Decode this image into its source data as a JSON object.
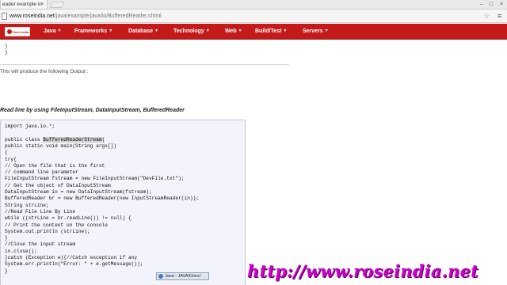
{
  "browser": {
    "tab_title": "eader example in",
    "tab_close": "×",
    "url_host": "www.roseindia.net",
    "url_path": "/java/example/java/io/BufferedReader.shtml",
    "controls": {
      "minimize": "–",
      "restore": "□",
      "close": "×"
    },
    "star_glyph": "☆",
    "menu_glyph": "≡"
  },
  "site": {
    "logo_text": "Rose India",
    "nav_items": [
      "Java",
      "Frameworks",
      "Database",
      "Technology",
      "Web",
      "Build/Test",
      "Servers"
    ],
    "caret": "▼"
  },
  "content": {
    "top_lines": [
      "}",
      "}"
    ],
    "output_text": "This will produce the following Output :",
    "section_heading": "Read line by using FileInputStream, DataInputStream, BufferedReader",
    "code_lines": [
      "import java.io.*;",
      "",
      "public class BufferedReaderStream{",
      "public static void main(String args[])",
      "{",
      "try{",
      "// Open the file that is the first",
      "// command line parameter",
      "FileInputStream fstream = new FileInputStream(\"DevFile.txt\");",
      "// Get the object of DataInputStream",
      "DataInputStream in = new DataInputStream(fstream);",
      "BufferedReader br = new BufferedReader(new InputStreamReader(in));",
      "String strLine;",
      "//Read File Line By Line",
      "while ((strLine = br.readLine()) != null) {",
      "// Print the content on the console",
      "System.out.println (strLine);",
      "}",
      "//Close the input stream",
      "in.close();",
      "}catch (Exception e){//Catch exception if any",
      "System.err.println(\"Error: \" + e.getMessage());",
      "}"
    ],
    "code_highlight": {
      "prefix": "public class ",
      "word": "BufferedReaderStream",
      "suffix": "{"
    }
  },
  "taskbar": {
    "label": "Java - JAVAIO/src/"
  },
  "watermark": "http://www.roseindia.net",
  "colors": {
    "nav_red": "#c41a1a",
    "watermark": "#cc00cc",
    "code_bg": "#f3f3fb"
  }
}
